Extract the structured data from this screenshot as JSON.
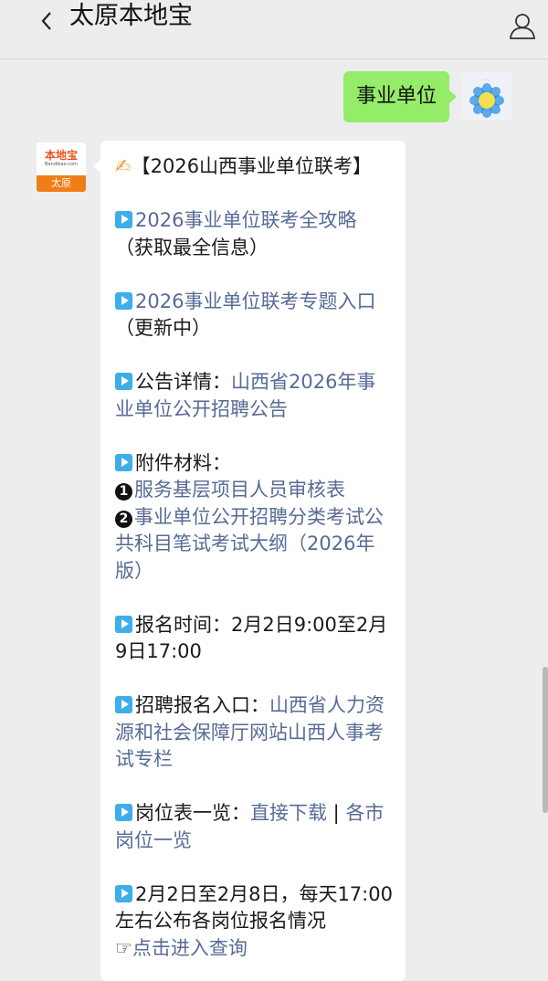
{
  "header": {
    "title": "太原本地宝",
    "back_icon": "chevron-left-icon",
    "user_icon": "user-icon"
  },
  "user_message": {
    "text": "事业单位"
  },
  "bot_avatar": {
    "brand": "本地宝",
    "url": "Bendibao.com",
    "city": "太原"
  },
  "message": {
    "heading_emoji": "✍",
    "heading": "【2026山西事业单位联考】",
    "item1_link": "2026事业单位联考全攻略",
    "item1_note": "（获取最全信息）",
    "item2_link": "2026事业单位联考专题入口",
    "item2_note": "（更新中）",
    "item3_label": "公告详情：",
    "item3_link": "山西省2026年事业单位公开招聘公告",
    "item4_label": "附件材料：",
    "attach1_num": "1",
    "attach1_link": "服务基层项目人员审核表",
    "attach2_num": "2",
    "attach2_link": "事业单位公开招聘分类考试公共科目笔试考试大纲（2026年版）",
    "item5_text": "报名时间：2月2日9:00至2月9日17:00",
    "item6_label": "招聘报名入口：",
    "item6_link": "山西省人力资源和社会保障厅网站山西人事考试专栏",
    "item7_label": "岗位表一览：",
    "item7_link1": "直接下载",
    "item7_sep": " | ",
    "item7_link2": "各市岗位一览",
    "item8_text": "2月2日至2月8日，每天17:00左右公布各岗位报名情况",
    "item8_pointer": "☞",
    "item8_link": "点击进入查询"
  }
}
